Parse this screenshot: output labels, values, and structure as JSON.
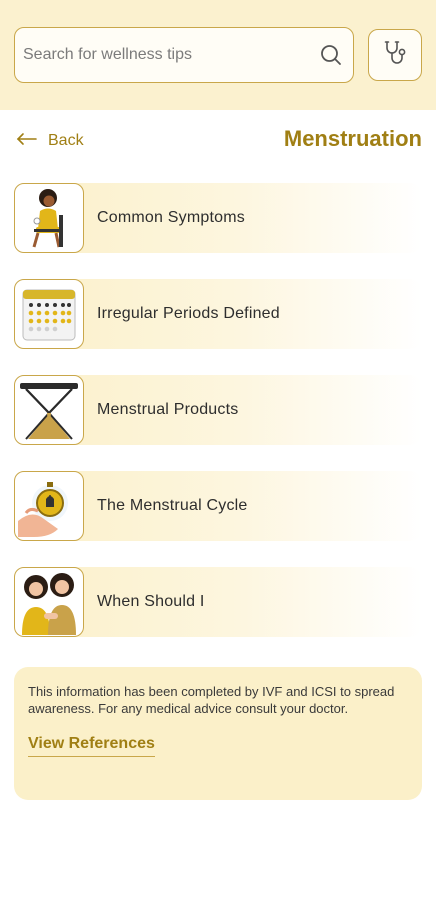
{
  "search": {
    "placeholder": "Search for wellness tips",
    "icon": "search-icon"
  },
  "header": {
    "back_label": "Back",
    "title": "Menstruation",
    "action_icon": "stethoscope-icon"
  },
  "topics": [
    {
      "label": "Common Symptoms",
      "icon": "woman-sitting-illustration"
    },
    {
      "label": "Irregular Periods Defined",
      "icon": "calendar-illustration"
    },
    {
      "label": "Menstrual Products",
      "icon": "hourglass-illustration"
    },
    {
      "label": "The Menstrual Cycle",
      "icon": "stopwatch-illustration"
    },
    {
      "label": "When Should I",
      "icon": "two-women-illustration"
    }
  ],
  "info": {
    "text": "This information has been completed by IVF and ICSI to spread awareness. For any medical advice consult your doctor.",
    "link_label": "View References"
  },
  "colors": {
    "accent": "#a07f14",
    "border": "#c9a74a",
    "band": "#fbf1cf",
    "card": "#fbf0c9"
  }
}
